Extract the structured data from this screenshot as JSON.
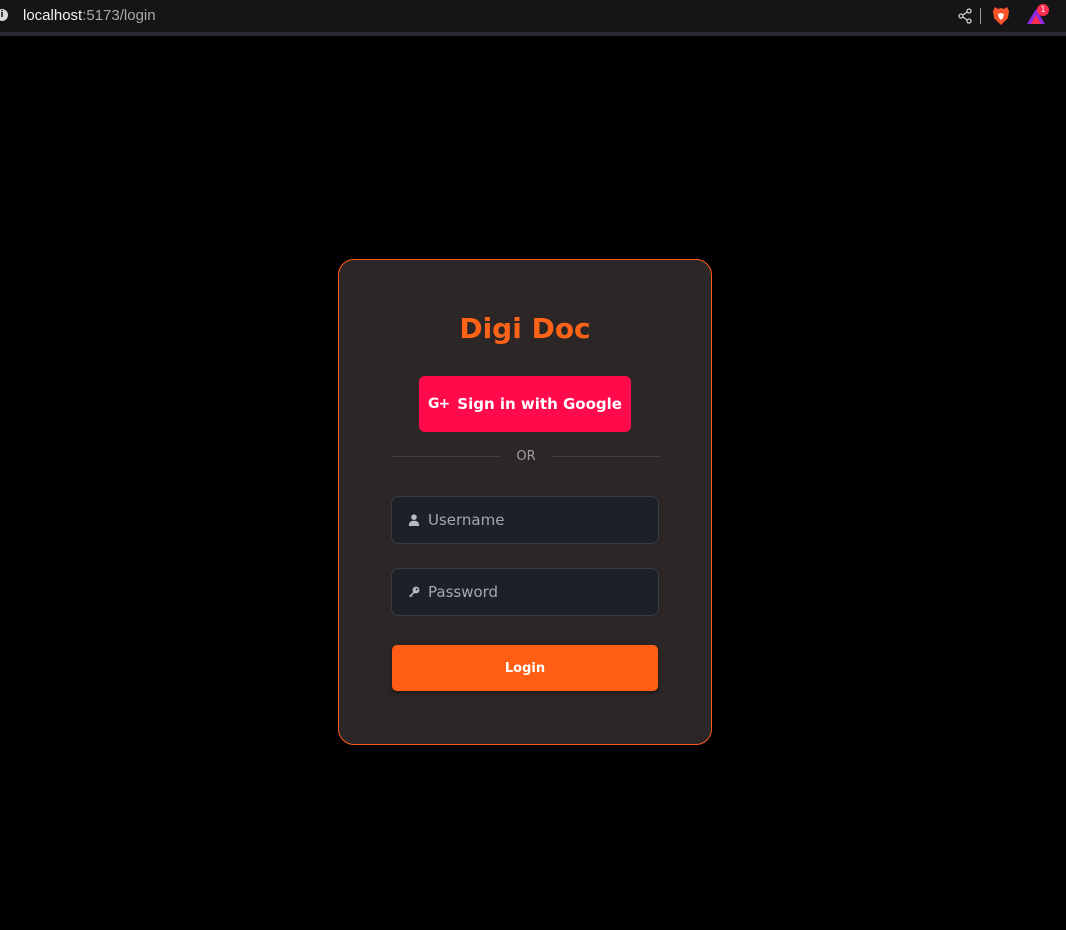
{
  "browser": {
    "url_host": "localhost",
    "url_rest": ":5173/login",
    "notification_count": "1",
    "icons": [
      "info-icon",
      "share-icon",
      "brave-shield-icon",
      "brave-rewards-icon"
    ]
  },
  "login": {
    "title": "Digi Doc",
    "google_button": {
      "icon": "google-plus-icon",
      "icon_text": "G+",
      "label": "Sign in with Google"
    },
    "divider_text": "OR",
    "username": {
      "icon": "user-icon",
      "placeholder": "Username",
      "value": ""
    },
    "password": {
      "icon": "key-icon",
      "placeholder": "Password",
      "value": ""
    },
    "submit_label": "Login"
  },
  "colors": {
    "accent": "#ff6318",
    "google_button": "#ff0a4b",
    "card_bg": "#2c2626",
    "input_bg": "#1c2027",
    "page_bg": "#000000"
  }
}
